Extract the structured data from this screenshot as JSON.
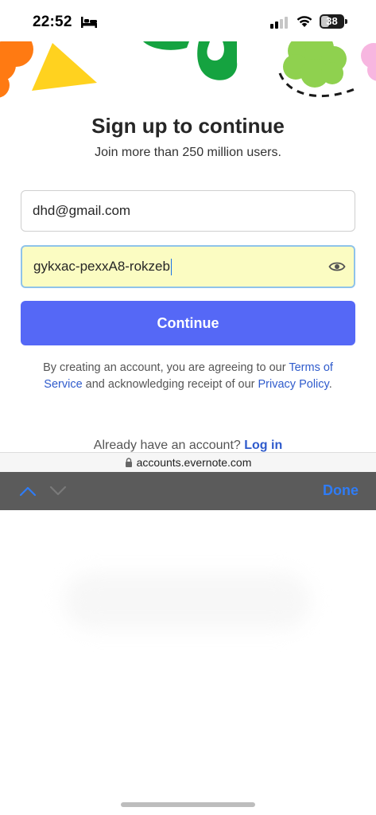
{
  "status_bar": {
    "time": "22:52",
    "battery": "38",
    "battery_level": 0.38,
    "icons": [
      "bed-icon",
      "cellular-signal-icon",
      "wifi-icon",
      "battery-icon"
    ]
  },
  "signup": {
    "title": "Sign up to continue",
    "subtitle": "Join more than 250 million users.",
    "email_value": "dhd@gmail.com",
    "password_value": "gykxac-pexxA8-rokzeb",
    "continue_label": "Continue",
    "legal_prefix": "By creating an account, you are agreeing to our",
    "terms_link": "Terms of Service",
    "legal_middle": "and acknowledging receipt of our",
    "privacy_link": "Privacy Policy",
    "legal_suffix": ".",
    "login_prompt": "Already have an account?",
    "login_link": "Log in"
  },
  "browser": {
    "url": "accounts.evernote.com"
  },
  "keyboard_toolbar": {
    "done_label": "Done"
  },
  "colors": {
    "primary_button": "#5568f6",
    "link": "#2f5bcc",
    "autofill_background": "#fbfcc2",
    "accessory_bar": "#5b5b5b",
    "done": "#2f7cf6"
  }
}
